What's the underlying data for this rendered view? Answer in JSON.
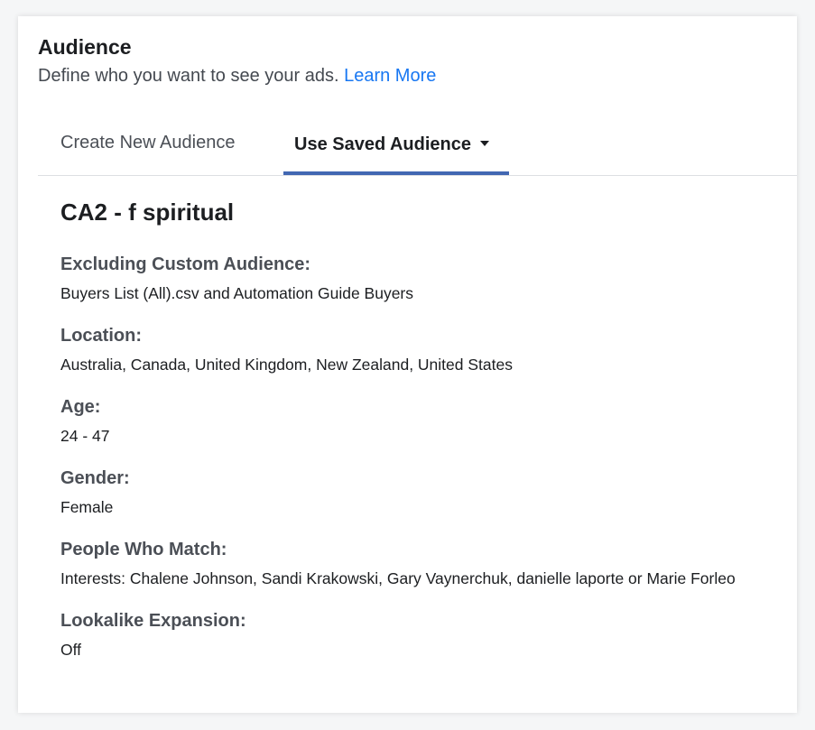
{
  "header": {
    "title": "Audience",
    "subtitle": "Define who you want to see your ads.",
    "learn_more": "Learn More"
  },
  "tabs": [
    {
      "label": "Create New Audience",
      "active": false
    },
    {
      "label": "Use Saved Audience",
      "active": true
    }
  ],
  "audience": {
    "name": "CA2 - f spiritual",
    "fields": [
      {
        "label": "Excluding Custom Audience:",
        "value": "Buyers List (All).csv and Automation Guide Buyers"
      },
      {
        "label": "Location:",
        "value": "Australia, Canada, United Kingdom, New Zealand, United States"
      },
      {
        "label": "Age:",
        "value": "24 - 47"
      },
      {
        "label": "Gender:",
        "value": "Female"
      },
      {
        "label": "People Who Match:",
        "value": "Interests: Chalene Johnson, Sandi Krakowski, Gary Vaynerchuk, danielle laporte or Marie Forleo"
      },
      {
        "label": "Lookalike Expansion:",
        "value": "Off"
      }
    ]
  },
  "colors": {
    "link": "#1877f2",
    "active_tab_underline": "#4267b2",
    "text_primary": "#1c1e21",
    "text_secondary": "#4b4f56"
  },
  "icons": {
    "tab_dropdown": "caret-down-icon"
  }
}
